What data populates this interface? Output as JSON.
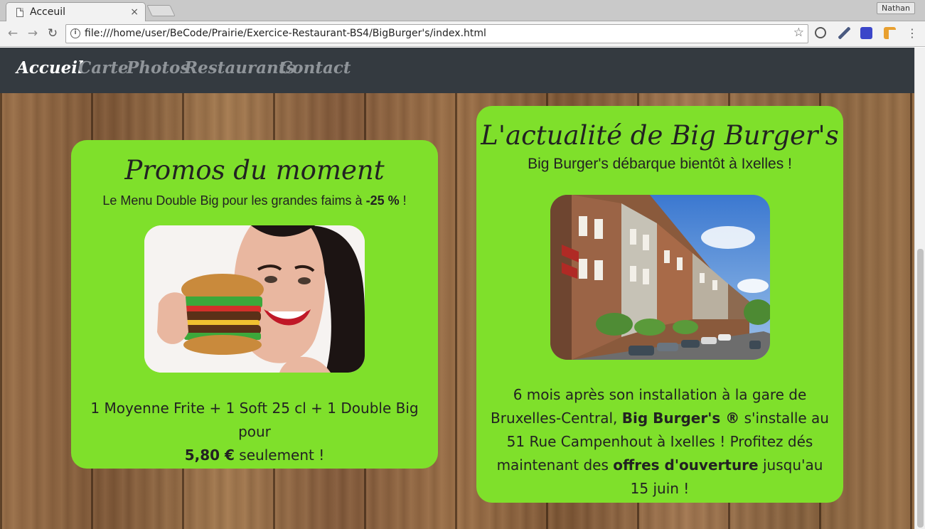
{
  "browser": {
    "tab_title": "Acceuil",
    "tab_close": "×",
    "profile_name": "Nathan",
    "url": "file:///home/user/BeCode/Prairie/Exercice-Restaurant-BS4/BigBurger's/index.html",
    "icons": [
      "back-icon",
      "forward-icon",
      "reload-icon",
      "info-icon",
      "star-icon",
      "menu-icon"
    ]
  },
  "nav": {
    "items": [
      "Accueil",
      "Carte",
      "Photos",
      "Restaurants",
      "Contact"
    ],
    "active": "Accueil"
  },
  "promo": {
    "title": "Promos du moment",
    "lead_text": "Le Menu Double Big pour les grandes faims à ",
    "lead_bold": "-25 %",
    "lead_end": " !",
    "body_text": "1 Moyenne Frite + 1 Soft 25 cl + 1 Double Big pour",
    "price": "5,80 €",
    "body_end": " seulement !"
  },
  "news": {
    "title": "L'actualité de Big Burger's",
    "subtitle": "Big Burger's débarque bientôt à Ixelles !",
    "body_1": "6 mois après son installation à la gare de Bruxelles-Central, ",
    "brand": "Big Burger's ®",
    "body_2": " s'installe au 51 Rue Campenhout à Ixelles ! Profitez dés maintenant des ",
    "offers": "offres d'ouverture",
    "body_3": " jusqu'au 15 juin !"
  },
  "colors": {
    "card_green": "#7fe02b",
    "navbar_bg": "#343a40",
    "nav_inactive": "#8f9499",
    "nav_active": "#ffffff"
  }
}
